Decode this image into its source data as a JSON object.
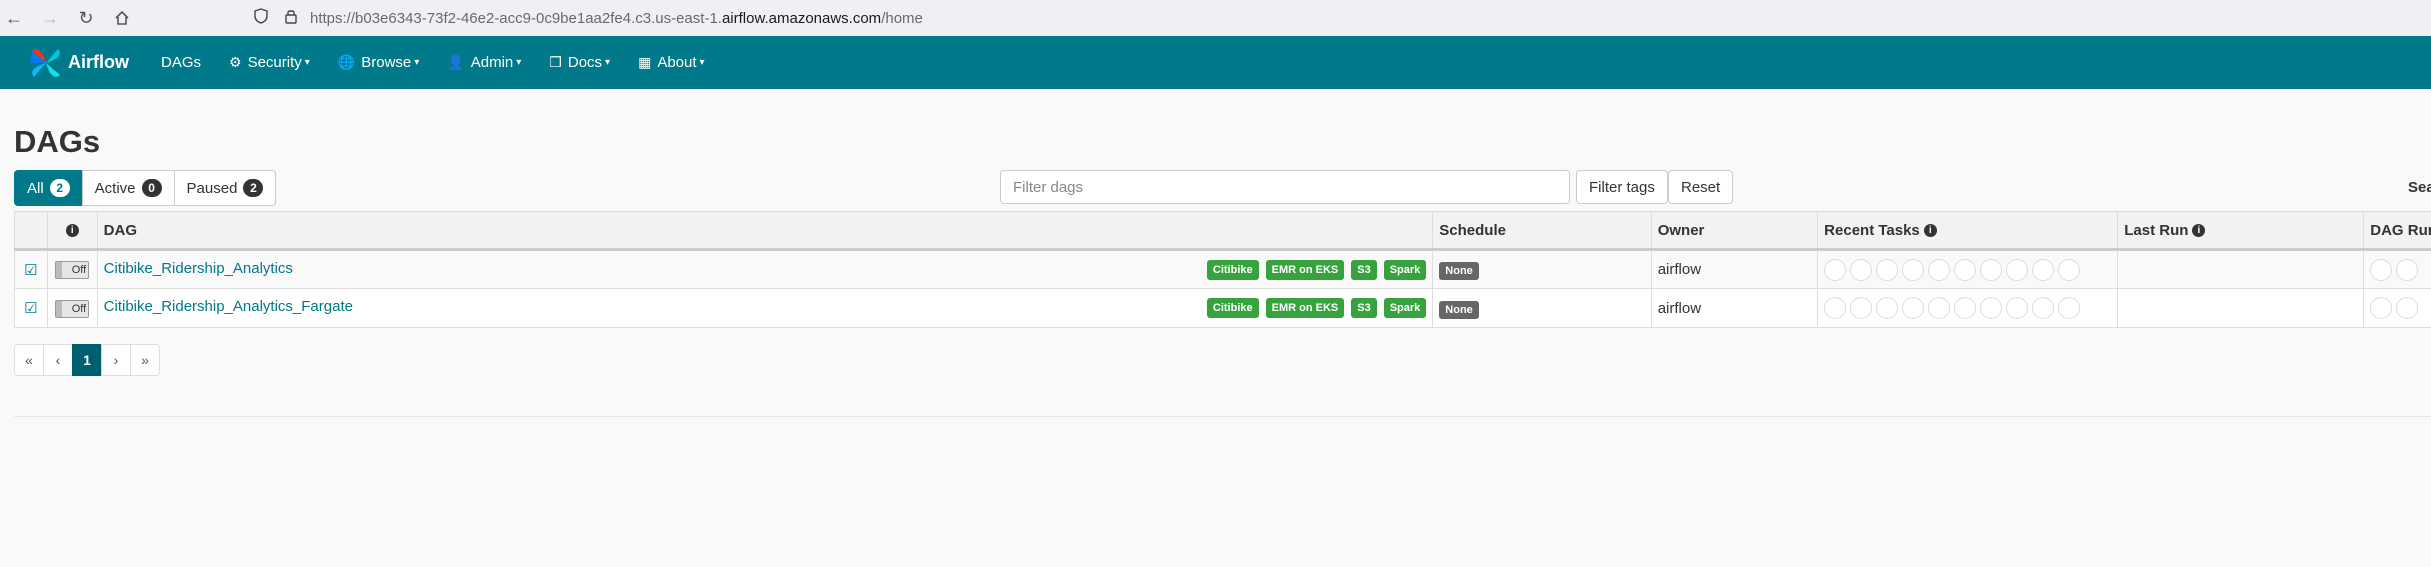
{
  "browser": {
    "back_icon": "arrow-left-icon",
    "forward_icon": "arrow-right-icon",
    "reload_icon": "reload-icon",
    "home_icon": "home-icon",
    "url_prefix": "https://b03e6343-73f2-46e2-acc9-0c9be1aa2fe4.c3.us-east-1.",
    "url_host": "airflow.amazonaws.com",
    "url_path": "/home"
  },
  "navbar": {
    "brand": "Airflow",
    "items": [
      {
        "label": "DAGs"
      },
      {
        "label": "Security",
        "icon": "gears-icon"
      },
      {
        "label": "Browse",
        "icon": "globe-icon"
      },
      {
        "label": "Admin",
        "icon": "user-icon"
      },
      {
        "label": "Docs",
        "icon": "cube-icon"
      },
      {
        "label": "About",
        "icon": "grid-icon"
      }
    ],
    "color": "#00798a"
  },
  "page": {
    "title": "DAGs",
    "status_filters": [
      {
        "label": "All",
        "count": "2",
        "active": true
      },
      {
        "label": "Active",
        "count": "0",
        "active": false
      },
      {
        "label": "Paused",
        "count": "2",
        "active": false
      }
    ],
    "filter_placeholder": "Filter dags",
    "filter_tags_label": "Filter tags",
    "reset_label": "Reset",
    "search_label": "Sea"
  },
  "table": {
    "headers": {
      "dag": "DAG",
      "schedule": "Schedule",
      "owner": "Owner",
      "recent_tasks": "Recent Tasks",
      "last_run": "Last Run",
      "dag_runs": "DAG Run"
    },
    "rows": [
      {
        "toggle": "Off",
        "name": "Citibike_Ridership_Analytics",
        "tags": [
          "Citibike",
          "EMR on EKS",
          "S3",
          "Spark"
        ],
        "schedule": "None",
        "owner": "airflow",
        "last_run": ""
      },
      {
        "toggle": "Off",
        "name": "Citibike_Ridership_Analytics_Fargate",
        "tags": [
          "Citibike",
          "EMR on EKS",
          "S3",
          "Spark"
        ],
        "schedule": "None",
        "owner": "airflow",
        "last_run": ""
      }
    ]
  },
  "pagination": {
    "first": "«",
    "prev": "‹",
    "current": "1",
    "next": "›",
    "last": "»"
  }
}
